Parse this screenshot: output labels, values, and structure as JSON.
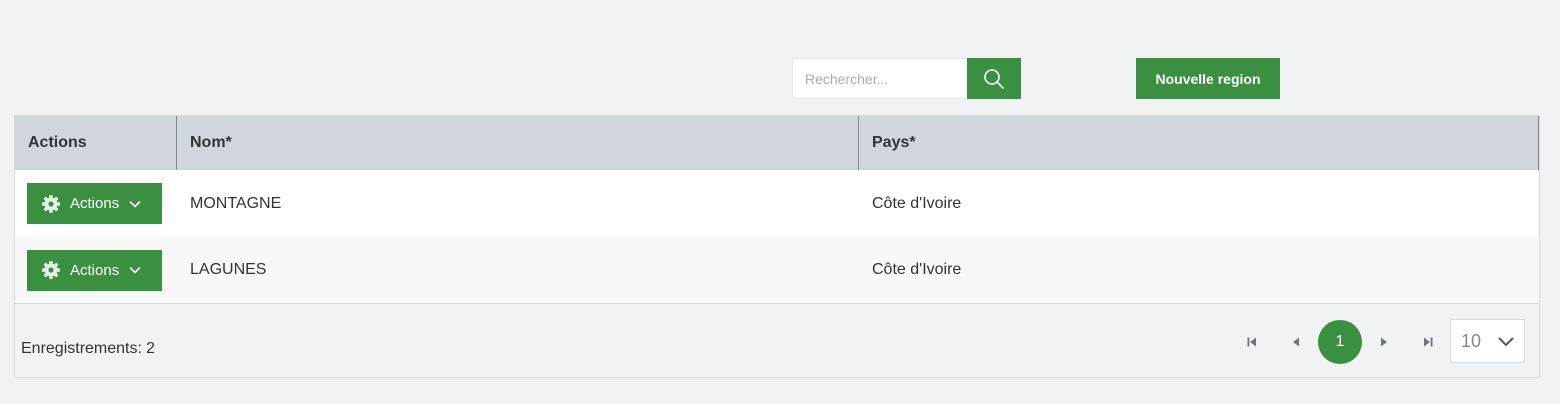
{
  "toolbar": {
    "search_placeholder": "Rechercher...",
    "new_button_label": "Nouvelle region"
  },
  "table": {
    "columns": [
      "Actions",
      "Nom*",
      "Pays*"
    ],
    "rows": [
      {
        "actions_label": "Actions",
        "nom": "MONTAGNE",
        "pays": "Côte d'Ivoire"
      },
      {
        "actions_label": "Actions",
        "nom": "LAGUNES",
        "pays": "Côte d'Ivoire"
      }
    ]
  },
  "footer": {
    "records_label": "Enregistrements:",
    "records_count": "2",
    "current_page": "1",
    "page_size": "10"
  },
  "colors": {
    "accent": "#3a9040",
    "header_bg": "#cfd7dd",
    "page_bg": "#f0f2f4"
  },
  "icons": {
    "search": "search-icon",
    "gear": "gear-icon",
    "chevron": "chevron-down-icon",
    "first": "first-page-icon",
    "prev": "prev-page-icon",
    "next": "next-page-icon",
    "last": "last-page-icon"
  }
}
